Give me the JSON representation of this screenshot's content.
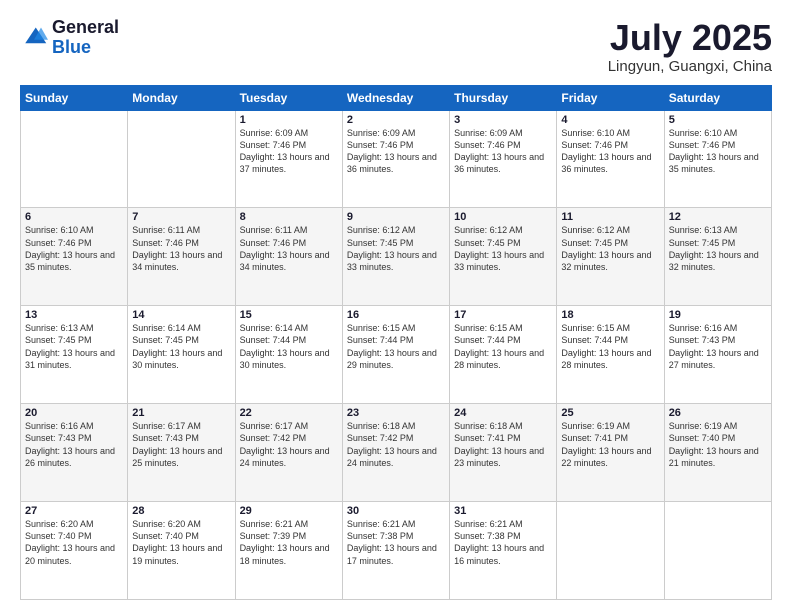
{
  "logo": {
    "general": "General",
    "blue": "Blue"
  },
  "title": "July 2025",
  "location": "Lingyun, Guangxi, China",
  "weekdays": [
    "Sunday",
    "Monday",
    "Tuesday",
    "Wednesday",
    "Thursday",
    "Friday",
    "Saturday"
  ],
  "weeks": [
    [
      {
        "day": "",
        "info": ""
      },
      {
        "day": "",
        "info": ""
      },
      {
        "day": "1",
        "info": "Sunrise: 6:09 AM\nSunset: 7:46 PM\nDaylight: 13 hours and 37 minutes."
      },
      {
        "day": "2",
        "info": "Sunrise: 6:09 AM\nSunset: 7:46 PM\nDaylight: 13 hours and 36 minutes."
      },
      {
        "day": "3",
        "info": "Sunrise: 6:09 AM\nSunset: 7:46 PM\nDaylight: 13 hours and 36 minutes."
      },
      {
        "day": "4",
        "info": "Sunrise: 6:10 AM\nSunset: 7:46 PM\nDaylight: 13 hours and 36 minutes."
      },
      {
        "day": "5",
        "info": "Sunrise: 6:10 AM\nSunset: 7:46 PM\nDaylight: 13 hours and 35 minutes."
      }
    ],
    [
      {
        "day": "6",
        "info": "Sunrise: 6:10 AM\nSunset: 7:46 PM\nDaylight: 13 hours and 35 minutes."
      },
      {
        "day": "7",
        "info": "Sunrise: 6:11 AM\nSunset: 7:46 PM\nDaylight: 13 hours and 34 minutes."
      },
      {
        "day": "8",
        "info": "Sunrise: 6:11 AM\nSunset: 7:46 PM\nDaylight: 13 hours and 34 minutes."
      },
      {
        "day": "9",
        "info": "Sunrise: 6:12 AM\nSunset: 7:45 PM\nDaylight: 13 hours and 33 minutes."
      },
      {
        "day": "10",
        "info": "Sunrise: 6:12 AM\nSunset: 7:45 PM\nDaylight: 13 hours and 33 minutes."
      },
      {
        "day": "11",
        "info": "Sunrise: 6:12 AM\nSunset: 7:45 PM\nDaylight: 13 hours and 32 minutes."
      },
      {
        "day": "12",
        "info": "Sunrise: 6:13 AM\nSunset: 7:45 PM\nDaylight: 13 hours and 32 minutes."
      }
    ],
    [
      {
        "day": "13",
        "info": "Sunrise: 6:13 AM\nSunset: 7:45 PM\nDaylight: 13 hours and 31 minutes."
      },
      {
        "day": "14",
        "info": "Sunrise: 6:14 AM\nSunset: 7:45 PM\nDaylight: 13 hours and 30 minutes."
      },
      {
        "day": "15",
        "info": "Sunrise: 6:14 AM\nSunset: 7:44 PM\nDaylight: 13 hours and 30 minutes."
      },
      {
        "day": "16",
        "info": "Sunrise: 6:15 AM\nSunset: 7:44 PM\nDaylight: 13 hours and 29 minutes."
      },
      {
        "day": "17",
        "info": "Sunrise: 6:15 AM\nSunset: 7:44 PM\nDaylight: 13 hours and 28 minutes."
      },
      {
        "day": "18",
        "info": "Sunrise: 6:15 AM\nSunset: 7:44 PM\nDaylight: 13 hours and 28 minutes."
      },
      {
        "day": "19",
        "info": "Sunrise: 6:16 AM\nSunset: 7:43 PM\nDaylight: 13 hours and 27 minutes."
      }
    ],
    [
      {
        "day": "20",
        "info": "Sunrise: 6:16 AM\nSunset: 7:43 PM\nDaylight: 13 hours and 26 minutes."
      },
      {
        "day": "21",
        "info": "Sunrise: 6:17 AM\nSunset: 7:43 PM\nDaylight: 13 hours and 25 minutes."
      },
      {
        "day": "22",
        "info": "Sunrise: 6:17 AM\nSunset: 7:42 PM\nDaylight: 13 hours and 24 minutes."
      },
      {
        "day": "23",
        "info": "Sunrise: 6:18 AM\nSunset: 7:42 PM\nDaylight: 13 hours and 24 minutes."
      },
      {
        "day": "24",
        "info": "Sunrise: 6:18 AM\nSunset: 7:41 PM\nDaylight: 13 hours and 23 minutes."
      },
      {
        "day": "25",
        "info": "Sunrise: 6:19 AM\nSunset: 7:41 PM\nDaylight: 13 hours and 22 minutes."
      },
      {
        "day": "26",
        "info": "Sunrise: 6:19 AM\nSunset: 7:40 PM\nDaylight: 13 hours and 21 minutes."
      }
    ],
    [
      {
        "day": "27",
        "info": "Sunrise: 6:20 AM\nSunset: 7:40 PM\nDaylight: 13 hours and 20 minutes."
      },
      {
        "day": "28",
        "info": "Sunrise: 6:20 AM\nSunset: 7:40 PM\nDaylight: 13 hours and 19 minutes."
      },
      {
        "day": "29",
        "info": "Sunrise: 6:21 AM\nSunset: 7:39 PM\nDaylight: 13 hours and 18 minutes."
      },
      {
        "day": "30",
        "info": "Sunrise: 6:21 AM\nSunset: 7:38 PM\nDaylight: 13 hours and 17 minutes."
      },
      {
        "day": "31",
        "info": "Sunrise: 6:21 AM\nSunset: 7:38 PM\nDaylight: 13 hours and 16 minutes."
      },
      {
        "day": "",
        "info": ""
      },
      {
        "day": "",
        "info": ""
      }
    ]
  ]
}
